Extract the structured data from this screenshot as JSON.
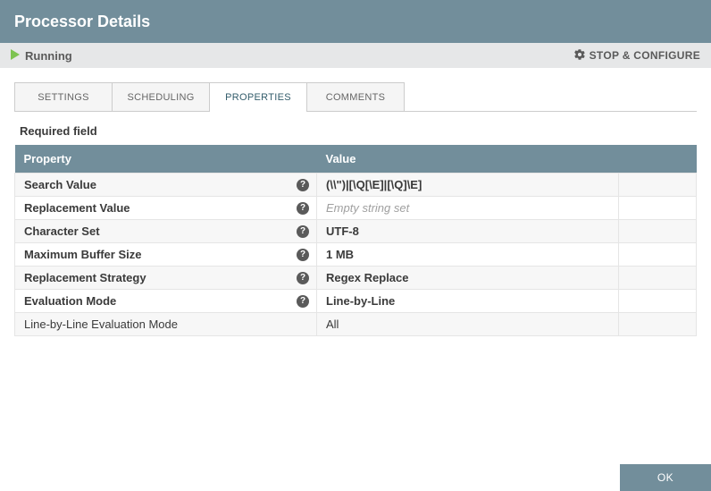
{
  "colors": {
    "primary": "#728e9b",
    "running": "#7dc351"
  },
  "header": {
    "title": "Processor Details"
  },
  "status": {
    "state": "Running",
    "stop_configure": "STOP & CONFIGURE"
  },
  "tabs": [
    {
      "id": "settings",
      "label": "SETTINGS",
      "active": false
    },
    {
      "id": "scheduling",
      "label": "SCHEDULING",
      "active": false
    },
    {
      "id": "properties",
      "label": "PROPERTIES",
      "active": true
    },
    {
      "id": "comments",
      "label": "COMMENTS",
      "active": false
    }
  ],
  "required_label": "Required field",
  "table": {
    "headers": {
      "property": "Property",
      "value": "Value"
    },
    "rows": [
      {
        "property": "Search Value",
        "bold": true,
        "help": true,
        "value": "(\\\\\")|[\\Q[\\E]|[\\Q]\\E]",
        "value_bold_mixed": true
      },
      {
        "property": "Replacement Value",
        "bold": true,
        "help": true,
        "value": "Empty string set",
        "placeholder": true
      },
      {
        "property": "Character Set",
        "bold": true,
        "help": true,
        "value": "UTF-8"
      },
      {
        "property": "Maximum Buffer Size",
        "bold": true,
        "help": true,
        "value": "1 MB"
      },
      {
        "property": "Replacement Strategy",
        "bold": true,
        "help": true,
        "value": "Regex Replace"
      },
      {
        "property": "Evaluation Mode",
        "bold": true,
        "help": true,
        "value": "Line-by-Line"
      },
      {
        "property": "Line-by-Line Evaluation Mode",
        "bold": false,
        "help": false,
        "value": "All",
        "value_bold": false
      }
    ]
  },
  "footer": {
    "ok": "OK"
  },
  "icons": {
    "help_glyph": "?"
  }
}
